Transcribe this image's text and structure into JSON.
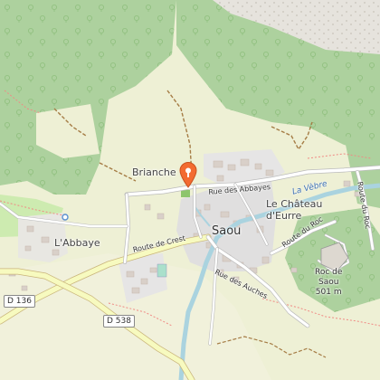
{
  "map": {
    "places": {
      "brianche": "Brianche",
      "labbaye": "L'Abbaye",
      "saou": "Saou",
      "chateau_line1": "Le Château",
      "chateau_line2": "d'Eurre",
      "roc_line1": "Roc de",
      "roc_line2": "Saou",
      "roc_elevation": "501 m"
    },
    "streets": {
      "rue_des_abbayes": "Rue des Abbayes",
      "route_de_crest": "Route de Crest",
      "rue_des_auches": "Rue des Auches",
      "route_du_roc": "Route du Roc",
      "route_du_roc_2": "Route du Roc"
    },
    "river": "La Vèbre",
    "roads": {
      "d136": "D 136",
      "d538": "D 538"
    },
    "marker_icon": "map-pin-marker-icon",
    "colors": {
      "forest": "#add19e",
      "farmland": "#eef0d5",
      "meadow": "#cdebb0",
      "water": "#aad3df",
      "marker": "#f36b31",
      "trunk_road": "#f7fabf"
    }
  }
}
